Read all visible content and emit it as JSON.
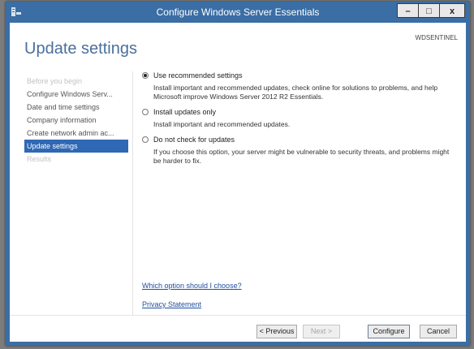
{
  "window": {
    "title": "Configure Windows Server Essentials",
    "controls": {
      "minimize": "–",
      "maximize": "□",
      "close": "x"
    }
  },
  "page": {
    "title": "Update settings",
    "server_name": "WDSENTINEL"
  },
  "sidebar": {
    "items": [
      {
        "label": "Before you begin",
        "state": "faded"
      },
      {
        "label": "Configure Windows Serv...",
        "state": "normal"
      },
      {
        "label": "Date and time settings",
        "state": "normal"
      },
      {
        "label": "Company information",
        "state": "normal"
      },
      {
        "label": "Create network admin ac...",
        "state": "normal"
      },
      {
        "label": "Update settings",
        "state": "active"
      },
      {
        "label": "Results",
        "state": "faded"
      }
    ]
  },
  "options": [
    {
      "label": "Use recommended settings",
      "selected": true,
      "description": "Install important and recommended updates, check online for solutions to problems, and help Microsoft improve Windows Server 2012 R2 Essentials."
    },
    {
      "label": "Install updates only",
      "selected": false,
      "description": "Install important and recommended updates."
    },
    {
      "label": "Do not check for updates",
      "selected": false,
      "description": "If you choose this option, your server might be vulnerable to security threats, and problems might be harder to fix."
    }
  ],
  "links": {
    "which_option": "Which option should I choose?",
    "privacy": "Privacy Statement"
  },
  "buttons": {
    "previous": "< Previous",
    "next": "Next >",
    "configure": "Configure",
    "cancel": "Cancel"
  },
  "colors": {
    "window_frame": "#3a6ea5",
    "accent": "#2f68b4",
    "title_text": "#4a6f9c",
    "link": "#1f4f9e"
  }
}
